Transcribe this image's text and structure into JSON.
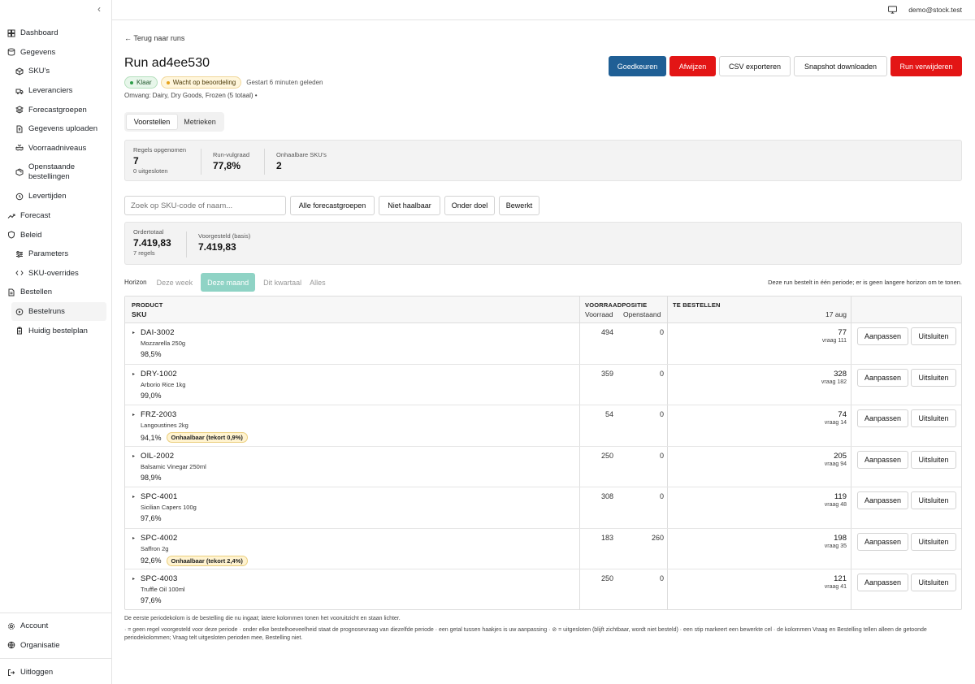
{
  "sidebar": {
    "items": [
      {
        "label": "Dashboard",
        "icon": "grid-icon"
      },
      {
        "label": "Gegevens",
        "icon": "database-icon"
      },
      {
        "label": "SKU's",
        "icon": "box-icon"
      },
      {
        "label": "Leveranciers",
        "icon": "truck-icon"
      },
      {
        "label": "Forecastgroepen",
        "icon": "layers-icon"
      },
      {
        "label": "Gegevens uploaden",
        "icon": "upload-file-icon"
      },
      {
        "label": "Voorraadniveaus",
        "icon": "boxes-icon"
      },
      {
        "label": "Openstaande bestellingen",
        "icon": "package-icon"
      },
      {
        "label": "Levertijden",
        "icon": "clock-icon"
      },
      {
        "label": "Forecast",
        "icon": "trend-icon"
      },
      {
        "label": "Beleid",
        "icon": "shield-icon"
      },
      {
        "label": "Parameters",
        "icon": "sliders-icon"
      },
      {
        "label": "SKU-overrides",
        "icon": "code-icon"
      },
      {
        "label": "Bestellen",
        "icon": "file-icon"
      },
      {
        "label": "Bestelruns",
        "icon": "play-icon"
      },
      {
        "label": "Huidig bestelplan",
        "icon": "clipboard-icon"
      }
    ],
    "bottom": [
      {
        "label": "Account",
        "icon": "gear-icon"
      },
      {
        "label": "Organisatie",
        "icon": "globe-icon"
      },
      {
        "label": "Uitloggen",
        "icon": "logout-icon"
      }
    ]
  },
  "topbar": {
    "user": "demo@stock.test"
  },
  "header": {
    "back": "← Terug naar runs",
    "title": "Run ad4ee530",
    "status_ready": "Klaar",
    "status_review": "Wacht op beoordeling",
    "started": "Gestart 6 minuten geleden",
    "scope": "Omvang: Dairy, Dry Goods, Frozen (5 totaal)  •",
    "actions": {
      "approve": "Goedkeuren",
      "reject": "Afwijzen",
      "csv": "CSV exporteren",
      "snapshot": "Snapshot downloaden",
      "delete": "Run verwijderen"
    }
  },
  "tabs": {
    "proposals": "Voorstellen",
    "metrics": "Metrieken"
  },
  "stats": {
    "rules_label": "Regels opgenomen",
    "rules_value": "7",
    "rules_sub": "0 uitgesloten",
    "fill_label": "Run-vulgraad",
    "fill_value": "77,8%",
    "unreach_label": "Onhaalbare SKU's",
    "unreach_value": "2"
  },
  "filters": {
    "search_placeholder": "Zoek op SKU-code of naam...",
    "all_groups": "Alle forecastgroepen",
    "not_feasible": "Niet haalbaar",
    "below_target": "Onder doel",
    "edited": "Bewerkt"
  },
  "totals": {
    "order_label": "Ordertotaal",
    "order_value": "7.419,83",
    "order_sub": "7 regels",
    "proposed_label": "Voorgesteld (basis)",
    "proposed_value": "7.419,83"
  },
  "horizon": {
    "label": "Horizon",
    "options": [
      "Deze week",
      "Deze maand",
      "Dit kwartaal",
      "Alles"
    ],
    "note": "Deze run bestelt in één periode; er is geen langere horizon om te tonen."
  },
  "table": {
    "h_product": "PRODUCT",
    "h_sku": "SKU",
    "h_stockpos": "VOORRAADPOSITIE",
    "h_stock": "Voorraad",
    "h_open": "Openstaand",
    "h_order": "TE BESTELLEN",
    "h_date": "17 aug",
    "btn_adjust": "Aanpassen",
    "btn_exclude": "Uitsluiten",
    "rows": [
      {
        "sku": "DAI-3002",
        "name": "Mozzarella 250g",
        "pct": "98,5%",
        "warn": "",
        "stock": "494",
        "open": "0",
        "order": "77",
        "demand": "vraag 111"
      },
      {
        "sku": "DRY-1002",
        "name": "Arborio Rice 1kg",
        "pct": "99,0%",
        "warn": "",
        "stock": "359",
        "open": "0",
        "order": "328",
        "demand": "vraag 182"
      },
      {
        "sku": "FRZ-2003",
        "name": "Langoustines 2kg",
        "pct": "94,1%",
        "warn": "Onhaalbaar (tekort 0,9%)",
        "stock": "54",
        "open": "0",
        "order": "74",
        "demand": "vraag 14"
      },
      {
        "sku": "OIL-2002",
        "name": "Balsamic Vinegar 250ml",
        "pct": "98,9%",
        "warn": "",
        "stock": "250",
        "open": "0",
        "order": "205",
        "demand": "vraag 94"
      },
      {
        "sku": "SPC-4001",
        "name": "Sicilian Capers 100g",
        "pct": "97,6%",
        "warn": "",
        "stock": "308",
        "open": "0",
        "order": "119",
        "demand": "vraag 48"
      },
      {
        "sku": "SPC-4002",
        "name": "Saffron 2g",
        "pct": "92,6%",
        "warn": "Onhaalbaar (tekort 2,4%)",
        "stock": "183",
        "open": "260",
        "order": "198",
        "demand": "vraag 35"
      },
      {
        "sku": "SPC-4003",
        "name": "Truffle Oil 100ml",
        "pct": "97,6%",
        "warn": "",
        "stock": "250",
        "open": "0",
        "order": "121",
        "demand": "vraag 41"
      }
    ]
  },
  "footer": {
    "line1": "De eerste periodekolom is de bestelling die nu ingaat; latere kolommen tonen het vooruitzicht en staan lichter.",
    "line2": "· = geen regel voorgesteld voor deze periode · onder elke bestelhoeveelheid staat de prognosevraag van diezelfde periode · een getal tussen haakjes is uw aanpassing · ⊘ = uitgesloten (blijft zichtbaar, wordt niet besteld) · een stip markeert een bewerkte cel · de kolommen Vraag en Bestelling tellen alleen de getoonde periodekolommen; Vraag telt uitgesloten perioden mee, Bestelling niet."
  },
  "colors": {
    "approve": "#1f5f95",
    "danger": "#e31515",
    "horizon_active": "#8fd3c5",
    "ok_badge": "#e7f6ea",
    "warn_badge": "#fff3d0"
  }
}
